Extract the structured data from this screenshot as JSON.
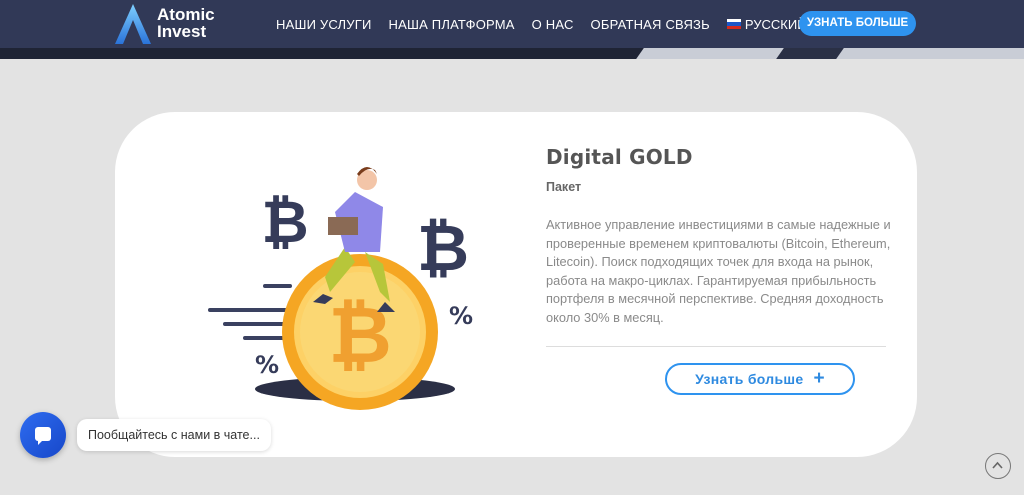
{
  "header": {
    "logo_line1": "Atomic",
    "logo_line2": "Invest",
    "nav": [
      {
        "label": "НАШИ УСЛУГИ"
      },
      {
        "label": "НАША ПЛАТФОРМА"
      },
      {
        "label": "О НАС"
      },
      {
        "label": "ОБРАТНАЯ СВЯЗЬ"
      }
    ],
    "language": "РУССКИЙ",
    "cta_label": "УЗНАТЬ БОЛЬШЕ"
  },
  "card": {
    "title": "Digital GOLD",
    "subtitle": "Пакет",
    "description": "Активное управление инвестициями в самые надежные и проверенные временем криптовалюты (Bitcoin, Ethereum, Litecoin). Поиск подходящих точек для входа на рынок, работа на макро-циклах. Гарантируемая прибыльность портфеля в месячной перспективе. Средняя доходность около 30% в месяц.",
    "button_label": "Узнать больше",
    "illustration": {
      "bitcoin_symbol": "₿",
      "percent_symbol": "%"
    }
  },
  "chat": {
    "prompt": "Пообщайтесь с нами в чате..."
  },
  "colors": {
    "header_bg": "#313957",
    "accent_blue": "#2e93ef",
    "coin_gold": "#f2b33d"
  }
}
